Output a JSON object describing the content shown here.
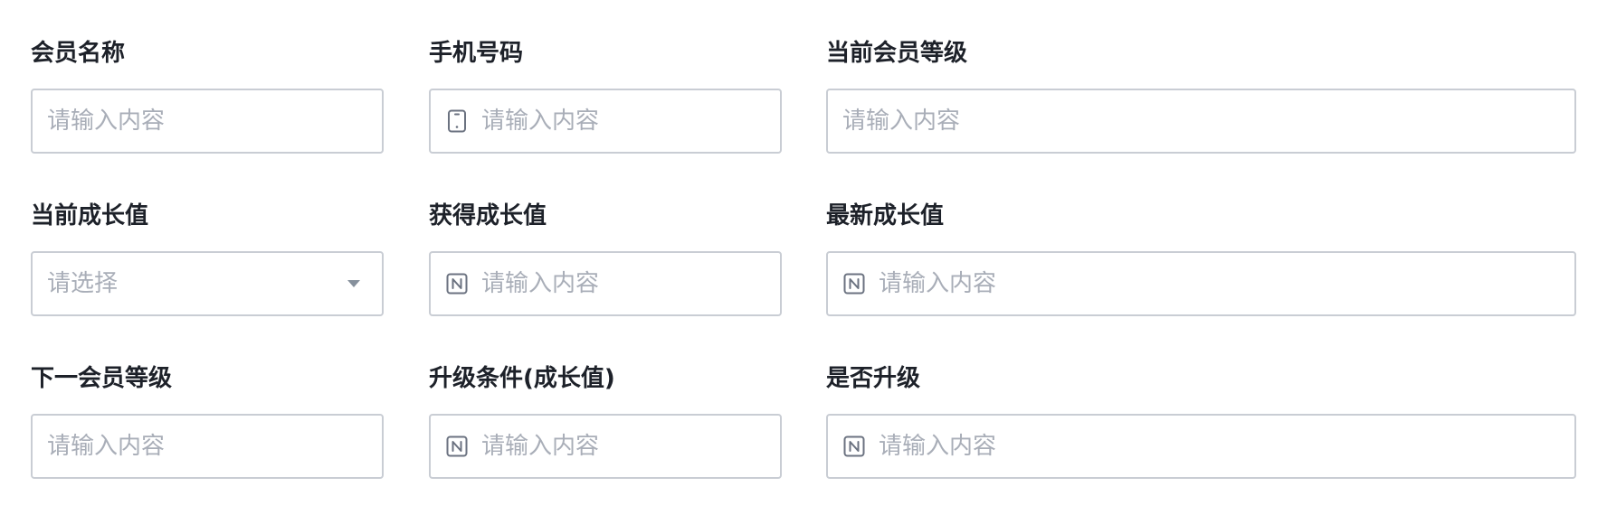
{
  "form": {
    "fields": {
      "member_name": {
        "label": "会员名称",
        "placeholder": "请输入内容"
      },
      "phone": {
        "label": "手机号码",
        "placeholder": "请输入内容",
        "icon": "phone-icon"
      },
      "current_level": {
        "label": "当前会员等级",
        "placeholder": "请输入内容"
      },
      "current_growth": {
        "label": "当前成长值",
        "placeholder": "请选择",
        "icon": "chevron-down-icon"
      },
      "gained_growth": {
        "label": "获得成长值",
        "placeholder": "请输入内容",
        "icon": "number-icon"
      },
      "latest_growth": {
        "label": "最新成长值",
        "placeholder": "请输入内容",
        "icon": "number-icon"
      },
      "next_level": {
        "label": "下一会员等级",
        "placeholder": "请输入内容"
      },
      "upgrade_condition": {
        "label": "升级条件(成长值)",
        "placeholder": "请输入内容",
        "icon": "number-icon"
      },
      "is_upgrade": {
        "label": "是否升级",
        "placeholder": "请输入内容",
        "icon": "number-icon"
      }
    }
  },
  "colors": {
    "border": "#c9cdd4",
    "placeholder": "#a9aeb8",
    "label": "#1d2129",
    "icon": "#6b7280"
  }
}
